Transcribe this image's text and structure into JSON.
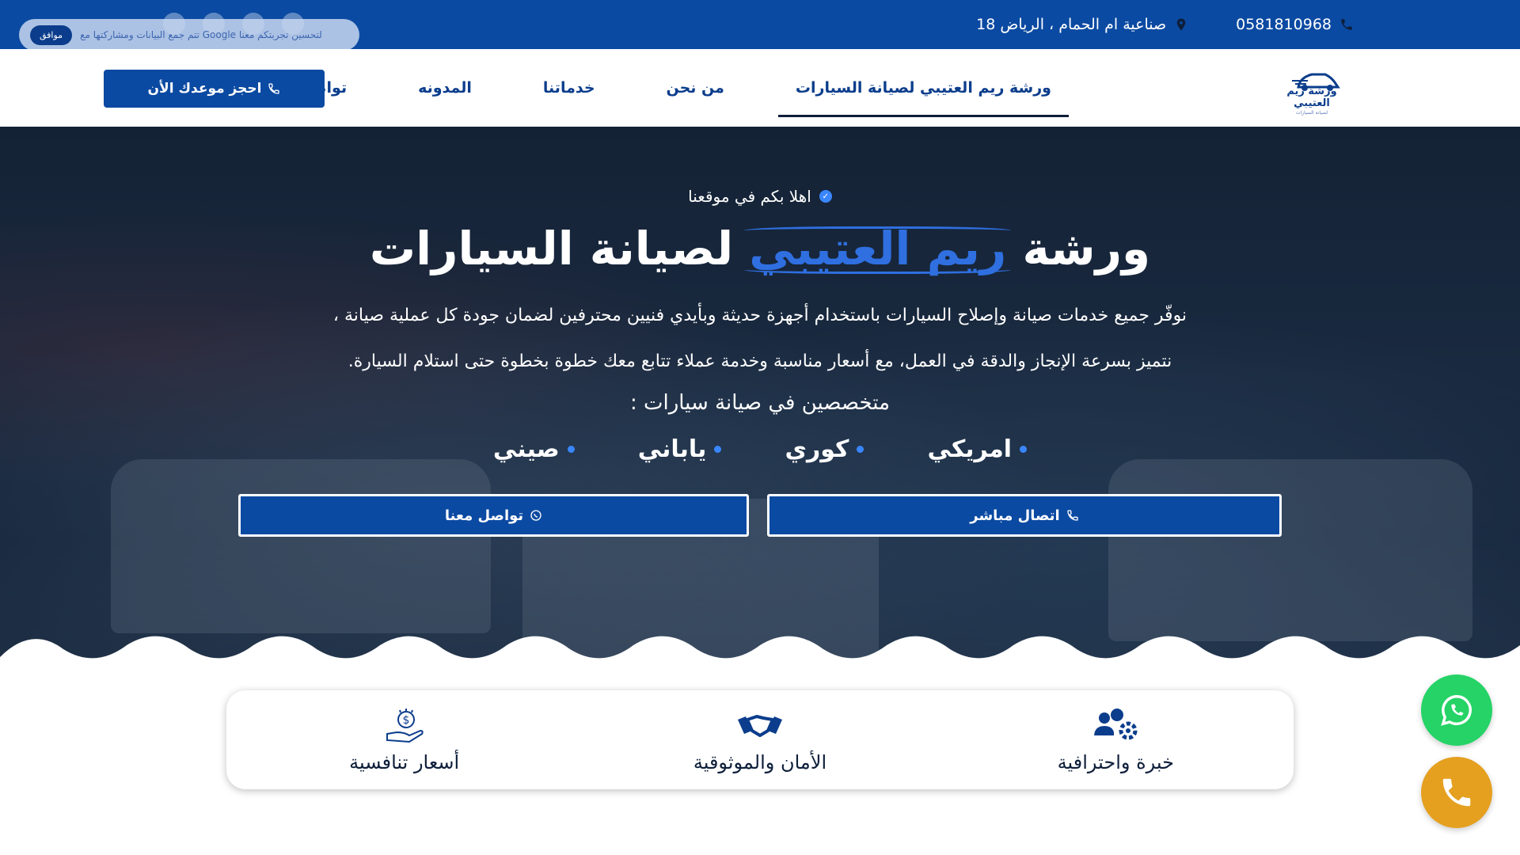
{
  "topbar": {
    "phone": "0581810968",
    "address": "18 صناعية ام الحمام ، الرياض"
  },
  "cookie": {
    "text": "تتم جمع البيانات ومشاركتها مع Google لتحسين تجربتكم معنا",
    "accept_label": "موافق"
  },
  "header": {
    "logo_caption": "ورشة ريم العتيبي",
    "logo_sub": "لصيانة السيارات",
    "nav": [
      {
        "label": "ورشة ريم العتيبي لصيانة السيارات",
        "active": true
      },
      {
        "label": "من نحن"
      },
      {
        "label": "خدماتنا"
      },
      {
        "label": "المدونه"
      },
      {
        "label": "تواصل معنا"
      }
    ],
    "book_label": "احجز موعدك الأن"
  },
  "hero": {
    "welcome": "اهلا بكم في موقعنا",
    "title_pre": "ورشة ",
    "title_highlight": "ريم العتيبي",
    "title_post": " لصيانة السيارات",
    "desc1": "نوفّر جميع خدمات صيانة وإصلاح السيارات باستخدام أجهزة حديثة وبأيدي فنيين محترفين لضمان جودة كل عملية صيانة ،",
    "desc2": "نتميز بسرعة الإنجاز والدقة في العمل، مع أسعار مناسبة وخدمة عملاء تتابع معك خطوة بخطوة حتى استلام السيارة.",
    "specialty": "متخصصين في صيانة سيارات :",
    "brands": [
      "امريكي",
      "كوري",
      "ياباني",
      "صيني"
    ],
    "call_label": "اتصال مباشر",
    "contact_label": "تواصل معنا"
  },
  "features": [
    {
      "label": "خبرة واحترافية",
      "icon": "users-gear-icon"
    },
    {
      "label": "الأمان والموثوقية",
      "icon": "handshake-icon"
    },
    {
      "label": "أسعار تنافسية",
      "icon": "money-hand-icon"
    }
  ],
  "colors": {
    "primary": "#0b4aa2",
    "accent": "#2f6fe0",
    "whatsapp": "#25d366",
    "call": "#e5a020"
  }
}
